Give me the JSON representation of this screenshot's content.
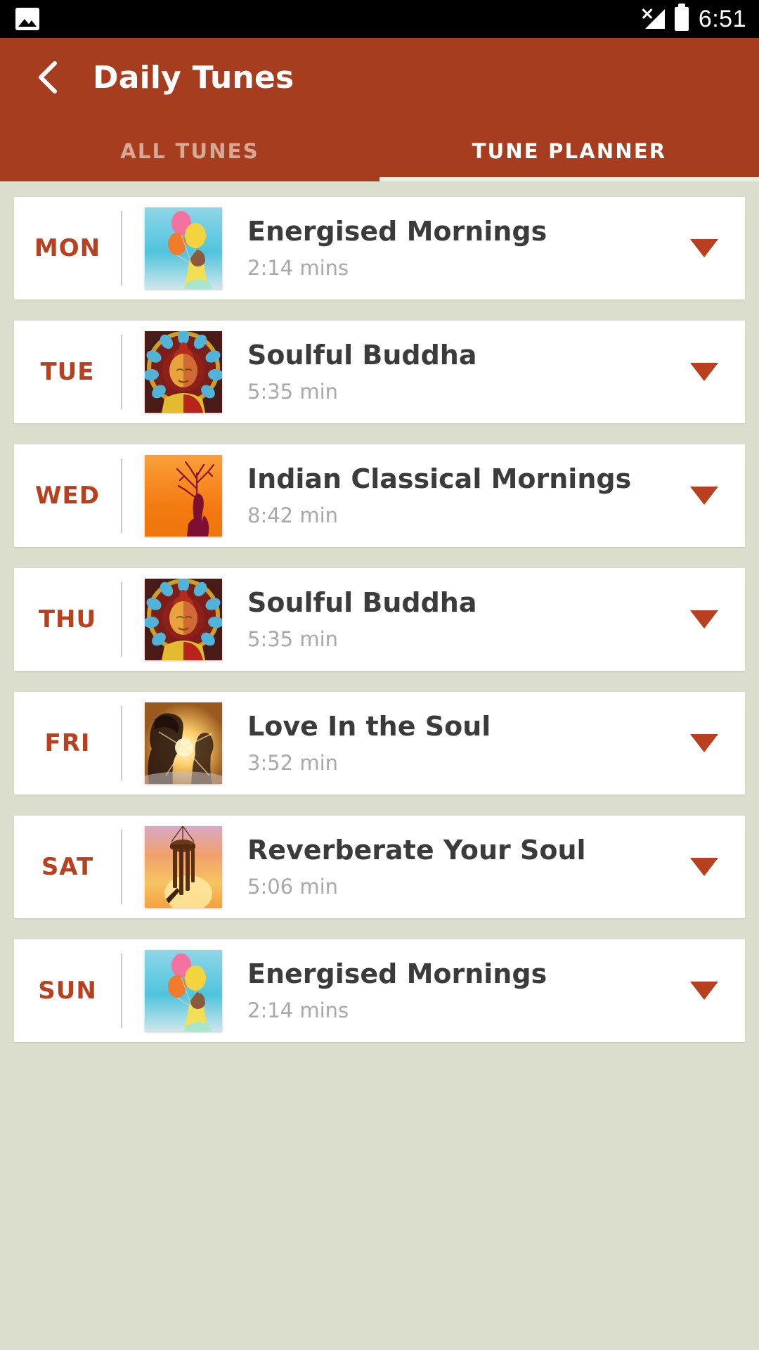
{
  "status_bar": {
    "photo_icon": "photo-icon",
    "signal_icon": "signal-no-service-icon",
    "battery_icon": "battery-icon",
    "time": "6:51"
  },
  "app_bar": {
    "back_icon": "back-chevron-icon",
    "title": "Daily Tunes",
    "background_color": "#a63d1f",
    "tabs": [
      {
        "label": "ALL TUNES",
        "active": false
      },
      {
        "label": "TUNE PLANNER",
        "active": true
      }
    ]
  },
  "theme": {
    "accent": "#b8401f",
    "header": "#a63d1f",
    "page_background": "#dcdecd",
    "card_background": "#ffffff",
    "title_text": "#3b3b3b",
    "duration_text": "#a8a8a8"
  },
  "planner": {
    "expand_icon": "chevron-down-icon",
    "rows": [
      {
        "day": "MON",
        "title": "Energised Mornings",
        "duration": "2:14 mins",
        "art": "balloons"
      },
      {
        "day": "TUE",
        "title": "Soulful Buddha",
        "duration": "5:35 min",
        "art": "buddha"
      },
      {
        "day": "WED",
        "title": "Indian Classical Mornings",
        "duration": "8:42 min",
        "art": "sunset-tree"
      },
      {
        "day": "THU",
        "title": "Soulful Buddha",
        "duration": "5:35 min",
        "art": "buddha"
      },
      {
        "day": "FRI",
        "title": "Love In the Soul",
        "duration": "3:52 min",
        "art": "couple-sunset"
      },
      {
        "day": "SAT",
        "title": "Reverberate Your Soul",
        "duration": "5:06 min",
        "art": "windchime"
      },
      {
        "day": "SUN",
        "title": "Energised Mornings",
        "duration": "2:14 mins",
        "art": "balloons"
      }
    ]
  }
}
